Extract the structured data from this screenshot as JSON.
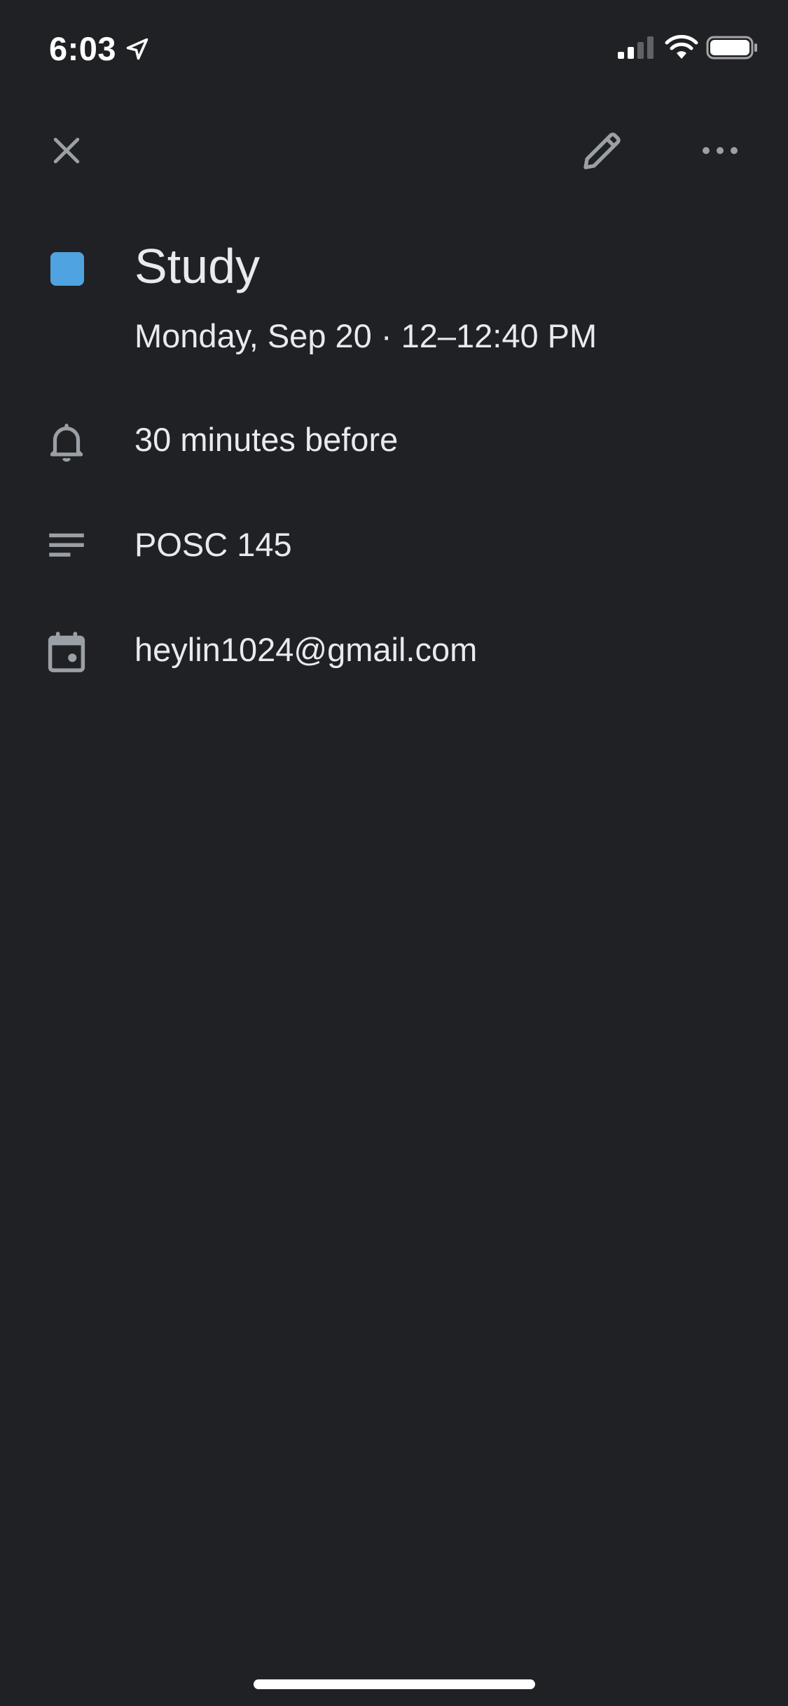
{
  "status_bar": {
    "time": "6:03",
    "icons": [
      "location-arrow-icon",
      "cellular-signal-icon",
      "wifi-icon",
      "battery-icon"
    ]
  },
  "toolbar": {
    "close_icon": "close-icon",
    "edit_icon": "edit-pencil-icon",
    "more_icon": "more-horizontal-icon"
  },
  "event": {
    "color": "#4fa3e0",
    "title": "Study",
    "datetime": "Monday, Sep 20 · 12–12:40 PM"
  },
  "details": {
    "reminder": "30 minutes before",
    "description": "POSC 145",
    "calendar": "heylin1024@gmail.com"
  },
  "colors": {
    "background": "#202124",
    "text": "#e8eaed",
    "icon": "#9aa0a6"
  }
}
